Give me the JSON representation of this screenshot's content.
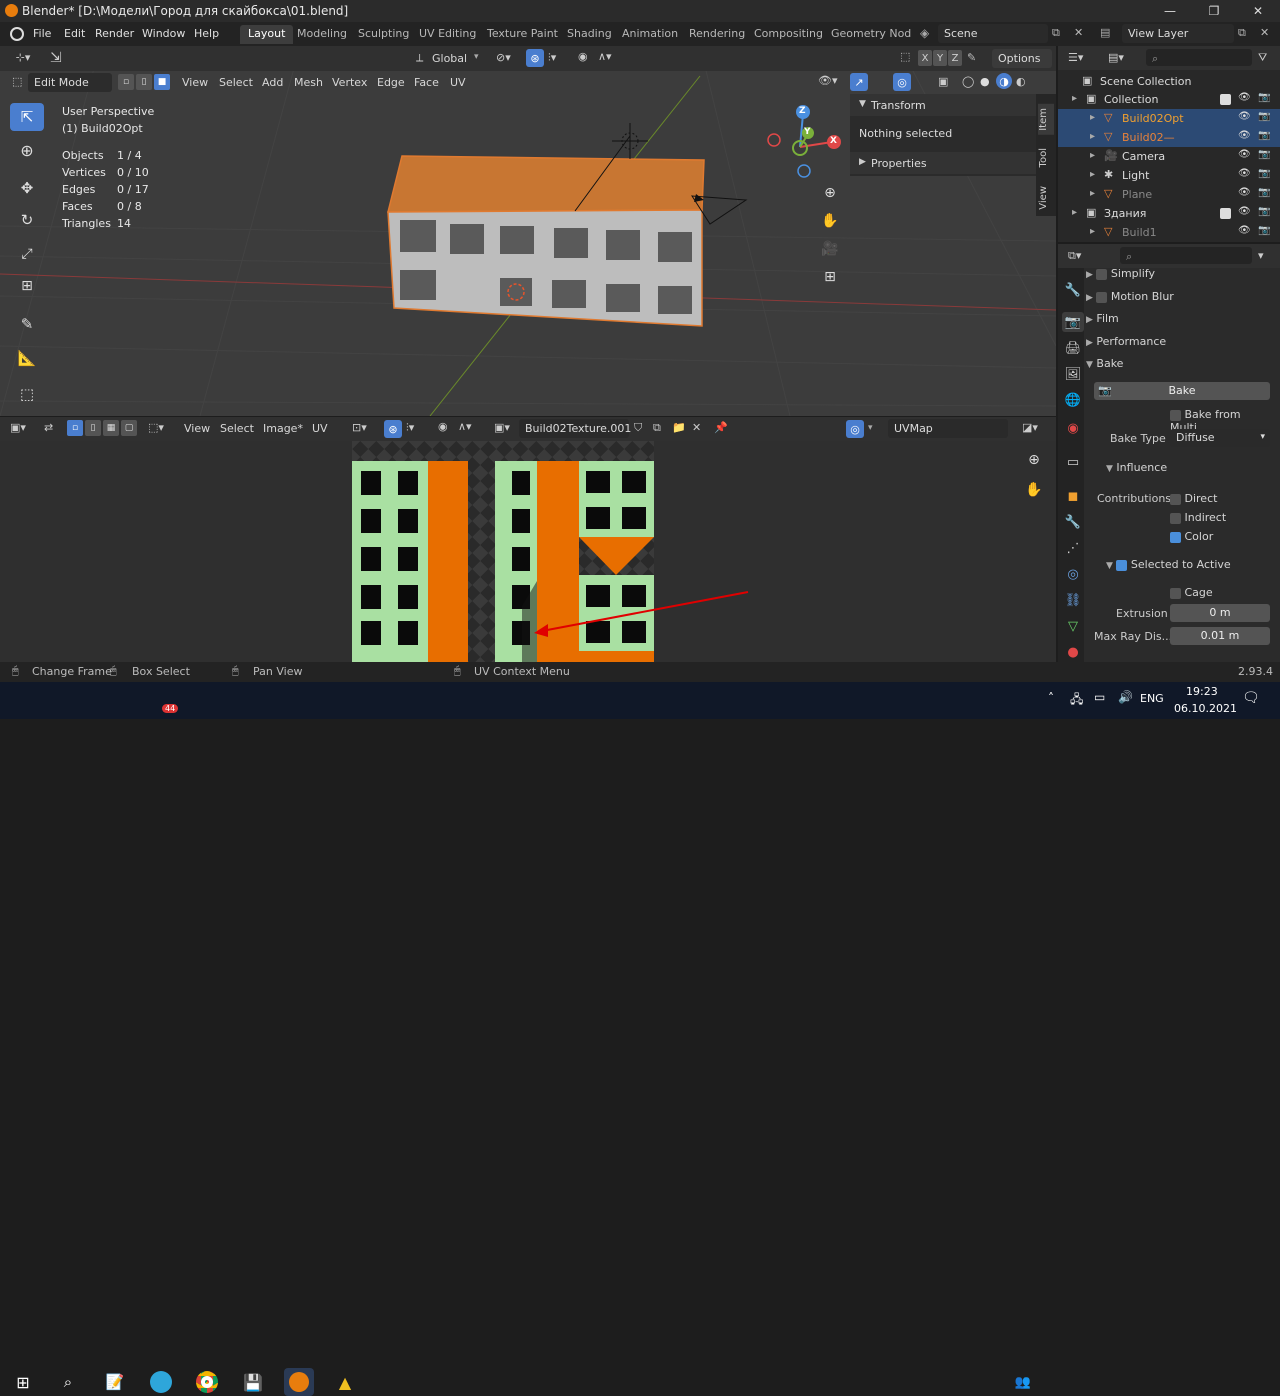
{
  "titlebar": {
    "title": "Blender* [D:\\Модели\\Город для скайбокса\\01.blend]",
    "minimize": "—",
    "maximize": "❐",
    "close": "✕"
  },
  "menu": {
    "file": "File",
    "edit": "Edit",
    "render": "Render",
    "window": "Window",
    "help": "Help"
  },
  "workspaces": [
    "Layout",
    "Modeling",
    "Sculpting",
    "UV Editing",
    "Texture Paint",
    "Shading",
    "Animation",
    "Rendering",
    "Compositing",
    "Geometry Nod"
  ],
  "scene": {
    "name": "Scene",
    "view_layer": "View Layer"
  },
  "viewport_header": {
    "mode": "Edit Mode",
    "view": "View",
    "select": "Select",
    "add": "Add",
    "mesh": "Mesh",
    "vertex": "Vertex",
    "edge": "Edge",
    "face": "Face",
    "uv": "UV",
    "orientation": "Global",
    "options": "Options",
    "x": "X",
    "y": "Y",
    "z": "Z"
  },
  "viewport_info": {
    "perspective": "User Perspective",
    "object": "(1) Build02Opt",
    "objects_label": "Objects",
    "objects": "1 / 4",
    "vertices_label": "Vertices",
    "vertices": "0 / 10",
    "edges_label": "Edges",
    "edges": "0 / 17",
    "faces_label": "Faces",
    "faces": "0 / 8",
    "triangles_label": "Triangles",
    "triangles": "14"
  },
  "npanel": {
    "transform": "Transform",
    "nothing": "Nothing selected",
    "properties": "Properties",
    "tabs": [
      "Item",
      "Tool",
      "View"
    ]
  },
  "gizmo": {
    "x": "X",
    "y": "Y",
    "z": "Z"
  },
  "uv_header": {
    "view": "View",
    "select": "Select",
    "image": "Image*",
    "uv": "UV",
    "image_name": "Build02Texture.001",
    "uvmap": "UVMap"
  },
  "outliner": {
    "scene_collection": "Scene Collection",
    "items": [
      {
        "name": "Collection",
        "indent": 0,
        "type": "collection"
      },
      {
        "name": "Build02Opt",
        "indent": 1,
        "type": "mesh",
        "selected": true,
        "color": "#f0a030"
      },
      {
        "name": "Build02—",
        "indent": 1,
        "type": "mesh",
        "selected": true,
        "color": "#e8823a"
      },
      {
        "name": "Camera",
        "indent": 1,
        "type": "camera"
      },
      {
        "name": "Light",
        "indent": 1,
        "type": "light"
      },
      {
        "name": "Plane",
        "indent": 1,
        "type": "mesh",
        "dim": true
      },
      {
        "name": "Здания",
        "indent": 0,
        "type": "collection"
      },
      {
        "name": "Build1",
        "indent": 1,
        "type": "mesh",
        "dim": true
      }
    ]
  },
  "properties": {
    "simplify": "Simplify",
    "motion_blur": "Motion Blur",
    "film": "Film",
    "performance": "Performance",
    "bake": "Bake",
    "bake_button": "Bake",
    "bake_from_multi": "Bake from Multi...",
    "bake_type_label": "Bake Type",
    "bake_type": "Diffuse",
    "influence": "Influence",
    "contributions": "Contributions",
    "direct": "Direct",
    "indirect": "Indirect",
    "color": "Color",
    "selected_to_active": "Selected to Active",
    "cage": "Cage",
    "extrusion_label": "Extrusion",
    "extrusion": "0 m",
    "max_ray_label": "Max Ray Dis...",
    "max_ray": "0.01 m"
  },
  "statusbar": {
    "change_frame": "Change Frame",
    "box_select": "Box Select",
    "pan_view": "Pan View",
    "uv_context": "UV Context Menu",
    "version": "2.93.4"
  },
  "taskbar": {
    "lang": "ENG",
    "time": "19:23",
    "date": "06.10.2021",
    "telegram_badge": "44"
  }
}
